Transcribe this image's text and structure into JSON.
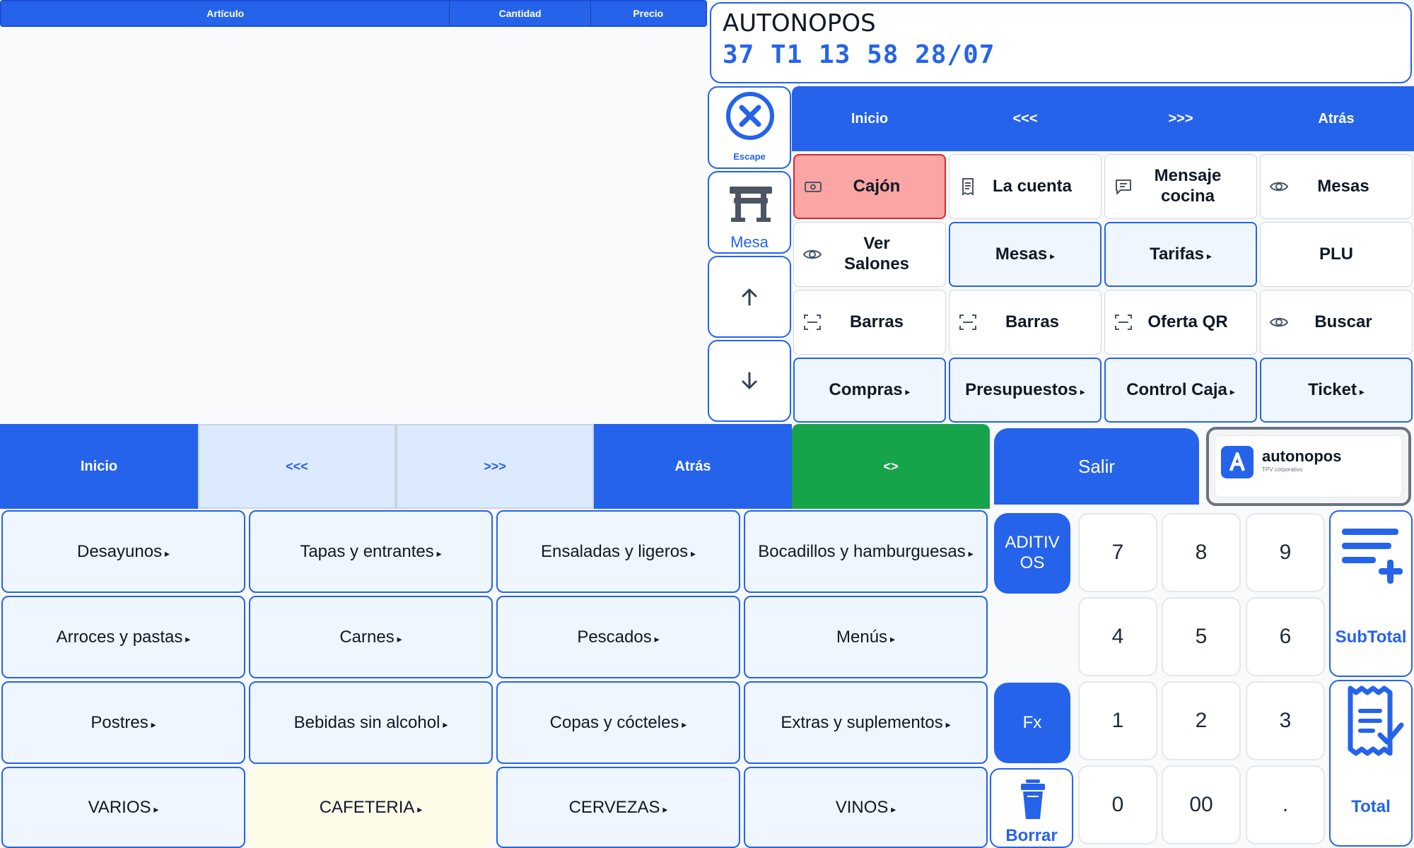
{
  "table": {
    "columns": [
      "Artículo",
      "Cantidad",
      "Precio"
    ]
  },
  "display": {
    "title": "AUTONOPOS",
    "info": "37  T1  13  58  28/07"
  },
  "side": {
    "escape_label": "Escape",
    "mesa_label": "Mesa"
  },
  "top_nav": [
    "Inicio",
    "<<<",
    ">>>",
    "Atrás"
  ],
  "functions": [
    {
      "label": "Cajón",
      "icon": "cash-icon"
    },
    {
      "label": "La cuenta",
      "icon": "receipt-icon"
    },
    {
      "label": "Mensaje cocina",
      "icon": "message-icon"
    },
    {
      "label": "Mesas",
      "icon": "eye-icon"
    },
    {
      "label": "Ver Salones",
      "icon": "eye-icon"
    },
    {
      "label": "Mesas",
      "icon": ""
    },
    {
      "label": "Tarifas",
      "icon": ""
    },
    {
      "label": "PLU",
      "icon": ""
    },
    {
      "label": "Barras",
      "icon": "barcode-scan-icon"
    },
    {
      "label": "Barras",
      "icon": "barcode-scan-icon"
    },
    {
      "label": "Oferta QR",
      "icon": "qr-scan-icon"
    },
    {
      "label": "Buscar",
      "icon": "eye-icon"
    },
    {
      "label": "Compras",
      "icon": ""
    },
    {
      "label": "Presupuestos",
      "icon": ""
    },
    {
      "label": "Control Caja",
      "icon": ""
    },
    {
      "label": "Ticket",
      "icon": ""
    }
  ],
  "bottom_nav": [
    "Inicio",
    "<<<",
    ">>>",
    "Atrás",
    "<>"
  ],
  "salir_label": "Salir",
  "logo": {
    "name": "autonopos",
    "tagline": "TPV corporativo"
  },
  "categories": [
    "Desayunos",
    "Tapas y entrantes",
    "Ensaladas y ligeros",
    "Bocadillos y hamburguesas",
    "Arroces y pastas",
    "Carnes",
    "Pescados",
    "Menús",
    "Postres",
    "Bebidas sin alcohol",
    "Copas y cócteles",
    "Extras y suplementos",
    "VARIOS",
    "CAFETERIA",
    "CERVEZAS",
    "VINOS"
  ],
  "keypad": {
    "aditivos_label": "ADITIV OS",
    "fx_label": "Fx",
    "borrar_label": "Borrar",
    "keys": [
      "7",
      "8",
      "9",
      "4",
      "5",
      "6",
      "1",
      "2",
      "3",
      "0",
      "00",
      "."
    ],
    "subtotal_label": "SubTotal",
    "total_label": "Total"
  },
  "colors": {
    "primary": "#2563eb",
    "green": "#16a34a",
    "danger_bg": "#fca5a5",
    "danger_border": "#dc2626",
    "light_blue": "#eff6ff",
    "cafeteria_bg": "#fefce8"
  }
}
